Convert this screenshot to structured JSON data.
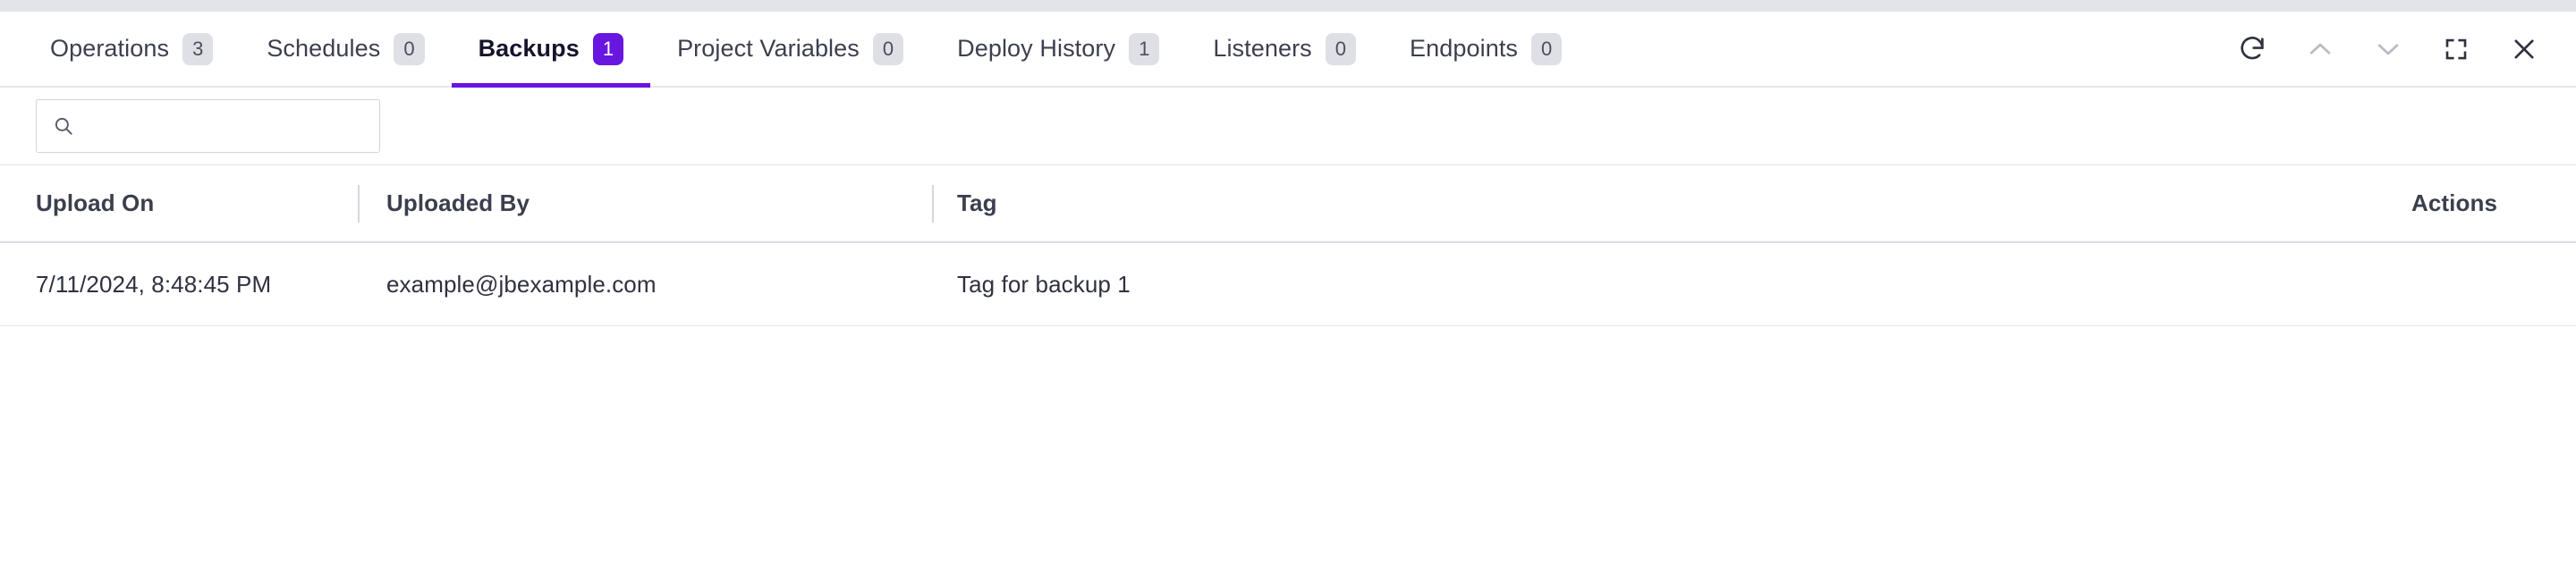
{
  "colors": {
    "accent": "#6816e0",
    "badge_bg": "#dfe0e6",
    "top_strip": "#e3e4e9",
    "border": "#e6e6ea"
  },
  "tabs": [
    {
      "label": "Operations",
      "count": "3",
      "active": false,
      "icon": ""
    },
    {
      "label": "Schedules",
      "count": "0",
      "active": false,
      "icon": ""
    },
    {
      "label": "Backups",
      "count": "1",
      "active": true,
      "icon": ""
    },
    {
      "label": "Project Variables",
      "count": "0",
      "active": false,
      "icon": ""
    },
    {
      "label": "Deploy History",
      "count": "1",
      "active": false,
      "icon": ""
    },
    {
      "label": "Listeners",
      "count": "0",
      "active": false,
      "icon": ""
    },
    {
      "label": "Endpoints",
      "count": "0",
      "active": false,
      "icon": ""
    }
  ],
  "window_controls": [
    {
      "name": "refresh-icon",
      "enabled": true
    },
    {
      "name": "chevron-up-icon",
      "enabled": false
    },
    {
      "name": "chevron-down-icon",
      "enabled": false
    },
    {
      "name": "fullscreen-icon",
      "enabled": true
    },
    {
      "name": "close-icon",
      "enabled": true
    }
  ],
  "search": {
    "value": "",
    "placeholder": "",
    "icon": "search-icon"
  },
  "table": {
    "columns": [
      {
        "key": "upload_on",
        "label": "Upload On"
      },
      {
        "key": "uploaded_by",
        "label": "Uploaded By"
      },
      {
        "key": "tag",
        "label": "Tag"
      },
      {
        "key": "actions",
        "label": "Actions"
      }
    ],
    "rows": [
      {
        "upload_on": "7/11/2024, 8:48:45 PM",
        "uploaded_by": "example@jbexample.com",
        "tag": "Tag for backup 1",
        "actions": ""
      }
    ]
  }
}
